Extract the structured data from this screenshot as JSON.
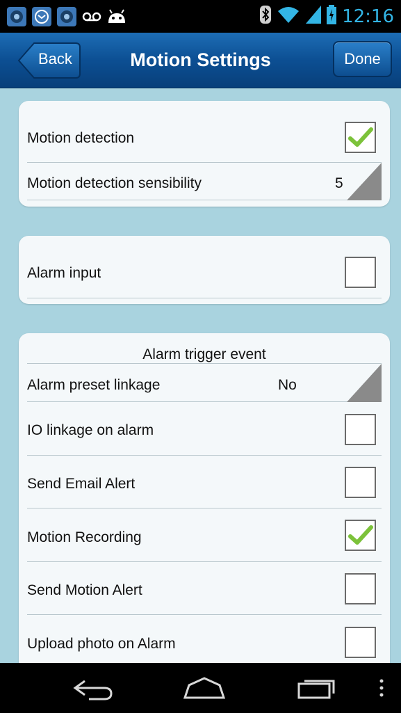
{
  "status_bar": {
    "time": "12:16",
    "left_icons": [
      "camera-app-icon",
      "mail-icon",
      "camera-app-icon",
      "voicemail-icon",
      "android-debug-icon"
    ],
    "right_icons": [
      "bluetooth-icon",
      "wifi-icon",
      "signal-icon",
      "battery-charging-icon"
    ],
    "accent_color": "#33b5e5"
  },
  "header": {
    "back_label": "Back",
    "title": "Motion Settings",
    "done_label": "Done"
  },
  "sections": {
    "motion": {
      "detection_label": "Motion detection",
      "detection_checked": true,
      "sensibility_label": "Motion detection sensibility",
      "sensibility_value": "5"
    },
    "alarm_input": {
      "label": "Alarm input",
      "checked": false
    },
    "trigger": {
      "title": "Alarm trigger event",
      "preset_label": "Alarm preset linkage",
      "preset_value": "No",
      "io_label": "IO linkage on alarm",
      "io_checked": false,
      "email_label": "Send Email Alert",
      "email_checked": false,
      "recording_label": "Motion Recording",
      "recording_checked": true,
      "alert_label": "Send Motion Alert",
      "alert_checked": false,
      "upload_label": "Upload photo on Alarm",
      "upload_checked": false
    }
  },
  "nav": {
    "icons": [
      "back-nav-icon",
      "home-nav-icon",
      "recent-apps-icon",
      "overflow-menu-icon"
    ]
  }
}
